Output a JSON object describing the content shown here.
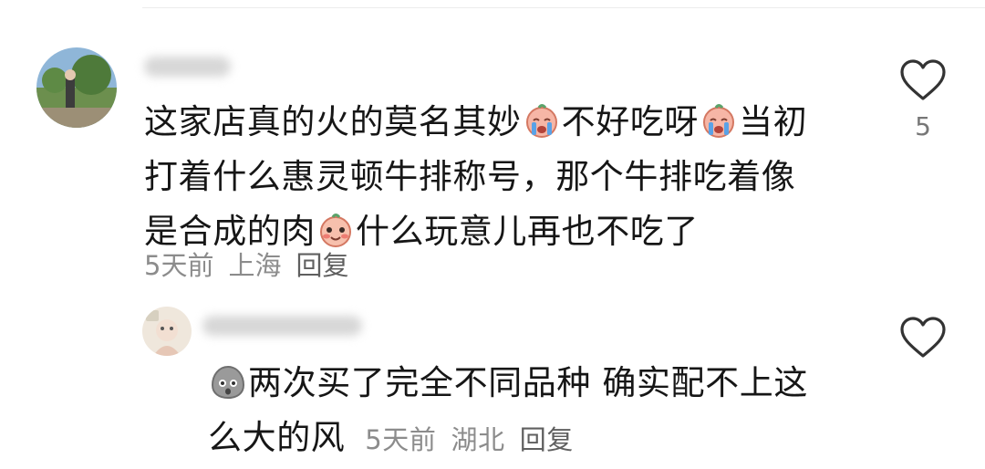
{
  "comments": [
    {
      "text_lines": [
        [
          "这家店真的火的莫名其妙",
          {
            "emoji": "crying-face-icon"
          },
          "不好吃呀",
          {
            "emoji": "crying-face-icon"
          },
          "当初"
        ],
        [
          "打着什么惠灵顿牛排称号，那个牛排吃着像"
        ],
        [
          "是合成的肉",
          {
            "emoji": "blushing-face-icon"
          },
          "什么玩意儿再也不吃了"
        ]
      ],
      "time": "5天前",
      "location": "上海",
      "reply_label": "回复",
      "like_count": "5"
    },
    {
      "text_lines": [
        [
          {
            "emoji": "gray-shocked-face-icon"
          },
          "两次买了完全不同品种 确实配不上这"
        ],
        [
          "么大的风"
        ]
      ],
      "time": "5天前",
      "location": "湖北",
      "reply_label": "回复",
      "like_count": ""
    }
  ],
  "colors": {
    "text": "#161616",
    "meta": "#8c8c8c",
    "heart_stroke": "#333333"
  }
}
